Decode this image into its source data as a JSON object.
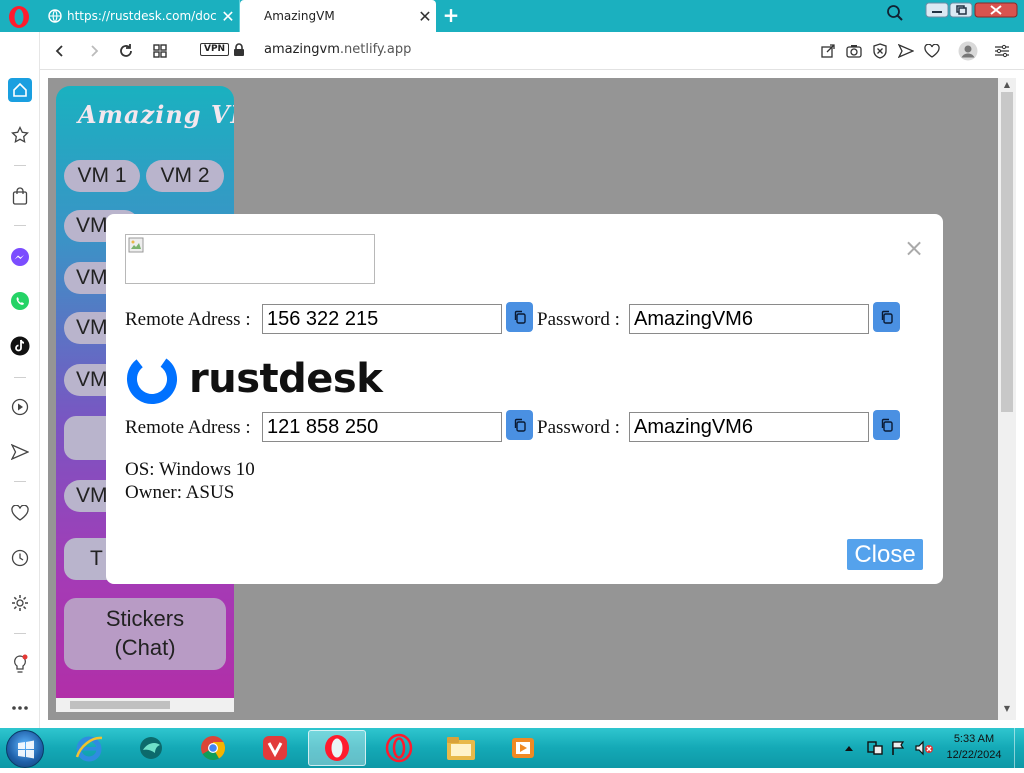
{
  "browser": {
    "tabs": [
      {
        "title": "https://rustdesk.com/docs/",
        "active": false
      },
      {
        "title": "AmazingVM",
        "active": true
      }
    ],
    "url_domain": "amazingvm",
    "url_rest": ".netlify.app",
    "vpn_label": "VPN"
  },
  "app": {
    "logo_text": "Amazing VM",
    "vm_buttons": [
      "VM 1",
      "VM 2",
      "VM",
      "VM",
      "VM",
      "VM",
      "",
      "VM",
      "T"
    ],
    "stickers_line1": "Stickers",
    "stickers_line2": "(Chat)"
  },
  "modal": {
    "rows": [
      {
        "address_label": "Remote Adress :",
        "address_value": "156 322 215",
        "password_label": "Password :",
        "password_value": "AmazingVM6"
      },
      {
        "address_label": "Remote Adress :",
        "address_value": "121 858 250",
        "password_label": "Password :",
        "password_value": "AmazingVM6"
      }
    ],
    "logo_text": "rustdesk",
    "os_line": "OS: Windows 10",
    "owner_line": "Owner: ASUS",
    "close_label": "Close",
    "close_symbol": "×"
  },
  "taskbar": {
    "time": "5:33 AM",
    "date": "12/22/2024"
  },
  "colors": {
    "tab_strip": "#1bb0bf",
    "copy_button": "#4a90e2",
    "close_button": "#55a2ec",
    "overlay": "#959595"
  }
}
